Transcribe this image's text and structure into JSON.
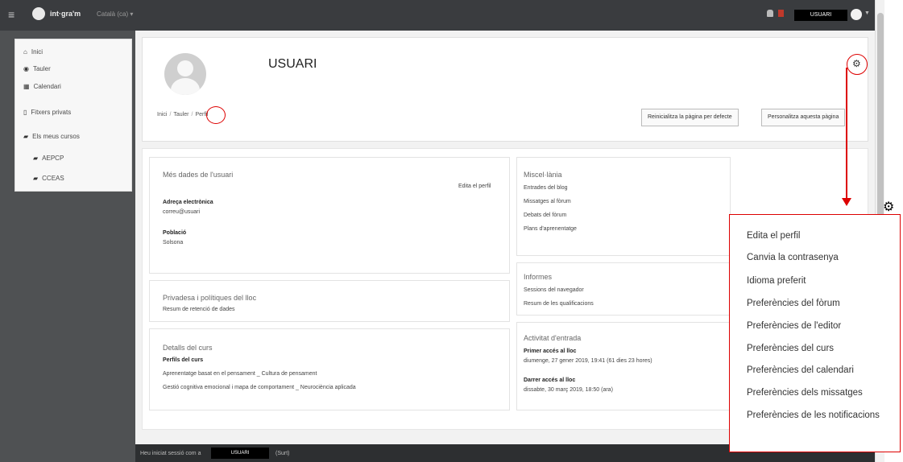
{
  "topbar": {
    "menu_icon": "hamburger-icon",
    "logo_text": "int·gra'm",
    "language": "Català (ca) ▾",
    "user_label": "USUARI"
  },
  "sidebar": {
    "items": [
      {
        "label": "Inici",
        "icon": "home-icon"
      },
      {
        "label": "Tauler",
        "icon": "dashboard-icon"
      },
      {
        "label": "Calendari",
        "icon": "calendar-icon"
      },
      {
        "label": "Fitxers privats",
        "icon": "file-icon"
      },
      {
        "label": "Els meus cursos",
        "icon": "graduation-cap-icon"
      },
      {
        "label": "AEPCP",
        "icon": "graduation-cap-icon"
      },
      {
        "label": "CCEAS",
        "icon": "graduation-cap-icon"
      }
    ]
  },
  "header": {
    "user_name": "USUARI",
    "breadcrumb": [
      "Inici",
      "Tauler",
      "Perfil"
    ],
    "reset_button": "Reinicialitza la pàgina per defecte",
    "customize_button": "Personalitza aquesta pàgina"
  },
  "details": {
    "title": "Més dades de l'usuari",
    "edit_link": "Edita el perfil",
    "email_label": "Adreça electrònica",
    "email_value": "correu@usuari",
    "town_label": "Població",
    "town_value": "Solsona"
  },
  "privacy": {
    "title": "Privadesa i polítiques del lloc",
    "link": "Resum de retenció de dades"
  },
  "course": {
    "title": "Detalls del curs",
    "subtitle": "Perfils del curs",
    "items": [
      "Aprenentatge basat en el pensament _ Cultura de pensament",
      "Gestió cognitiva emocional i mapa de comportament _ Neurociència aplicada"
    ]
  },
  "misc": {
    "title": "Miscel·lània",
    "items": [
      "Entrades del blog",
      "Missatges al fòrum",
      "Debats del fòrum",
      "Plans d'aprenentatge"
    ]
  },
  "reports": {
    "title": "Informes",
    "items": [
      "Sessions del navegador",
      "Resum de les qualificacions"
    ]
  },
  "login": {
    "title": "Activitat d'entrada",
    "first_label": "Primer accés al lloc",
    "first_value": "diumenge, 27 gener 2019, 19:41  (61 dies 23 hores)",
    "last_label": "Darrer accés al lloc",
    "last_value": "dissabte, 30 març 2019, 18:50  (ara)"
  },
  "footer": {
    "prefix": "Heu iniciat sessió com a",
    "user": "USUARI",
    "suffix": "(Surt)"
  },
  "menu": {
    "items": [
      "Edita el perfil",
      "Canvia la contrasenya",
      "Idioma preferit",
      "Preferències del fòrum",
      "Preferències de l'editor",
      "Preferències del curs",
      "Preferències del calendari",
      "Preferències dels missatges",
      "Preferències de les notificacions"
    ]
  },
  "colors": {
    "annotation": "#dd0000",
    "navbar": "#3a3c3f"
  }
}
